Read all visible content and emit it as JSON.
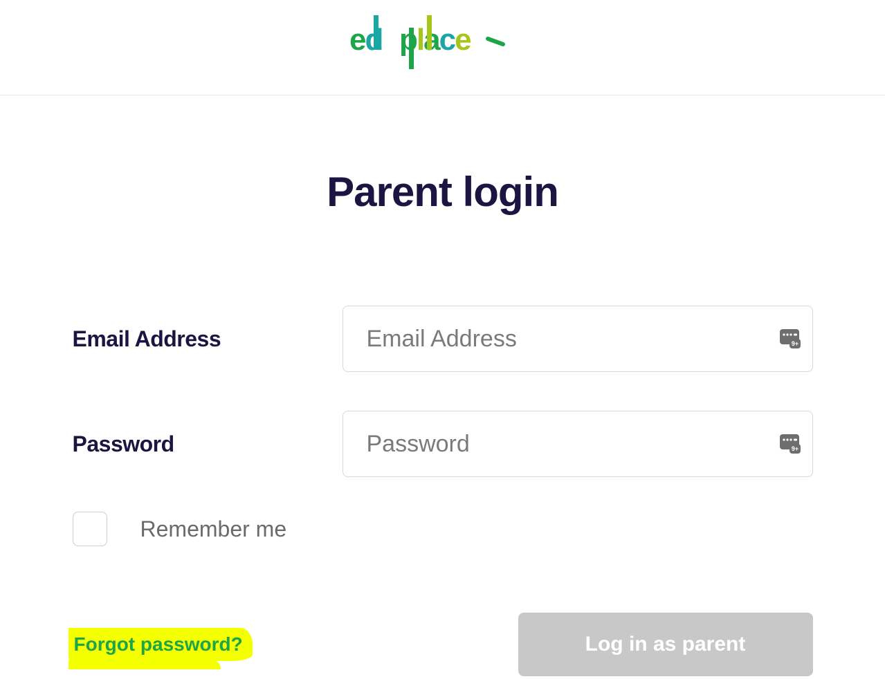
{
  "brand": {
    "name": "ed place"
  },
  "page": {
    "title": "Parent login"
  },
  "form": {
    "email": {
      "label": "Email Address",
      "placeholder": "Email Address",
      "value": ""
    },
    "password": {
      "label": "Password",
      "placeholder": "Password",
      "value": ""
    },
    "remember": {
      "label": "Remember me",
      "checked": false
    },
    "forgot": {
      "label": "Forgot password?"
    },
    "submit": {
      "label": "Log in as parent"
    }
  },
  "colors": {
    "heading": "#1d1441",
    "link": "#1ea54a",
    "highlight": "#f4ff00",
    "button_bg": "#c8c8c8",
    "brand_teal": "#1aa7a3",
    "brand_green": "#1ea54a",
    "brand_lime": "#a6c61a"
  }
}
